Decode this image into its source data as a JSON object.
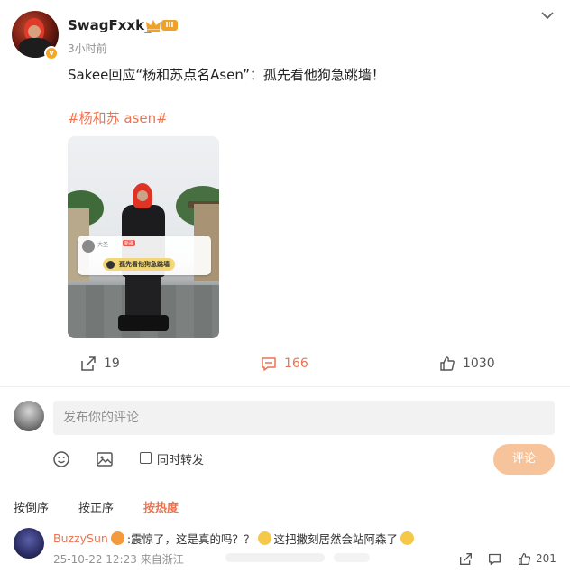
{
  "post": {
    "username": "SwagFxxk_",
    "level_badge": "III",
    "verified_mark": "v",
    "time": "3小时前",
    "text": "Sakee回应“杨和苏点名Asen”：孤先看他狗急跳墙！",
    "hashtag": "#杨和苏 asen#",
    "image_overlay": {
      "name": "大圣",
      "tag": "新歌",
      "caption": "孤先看他狗急跳墙"
    }
  },
  "actions": {
    "share_count": "19",
    "comment_count": "166",
    "like_count": "1030",
    "accent_color": "#eb7350"
  },
  "composer": {
    "placeholder": "发布你的评论",
    "repost_label": "同时转发",
    "submit_label": "评论"
  },
  "sort_tabs": [
    "按倒序",
    "按正序",
    "按热度"
  ],
  "comments": [
    {
      "user": "BuzzySun",
      "text_part1": ":震惊了，这是真的吗？？",
      "text_part2": "这把撒刻居然会站阿森了",
      "date": "25-10-22 12:23",
      "location": "来自浙江",
      "like_count": "201"
    }
  ],
  "icons": [
    "chevron-down-icon",
    "crown-icon",
    "share-icon",
    "comment-icon",
    "like-icon",
    "emoji-icon",
    "image-icon",
    "checkbox"
  ]
}
